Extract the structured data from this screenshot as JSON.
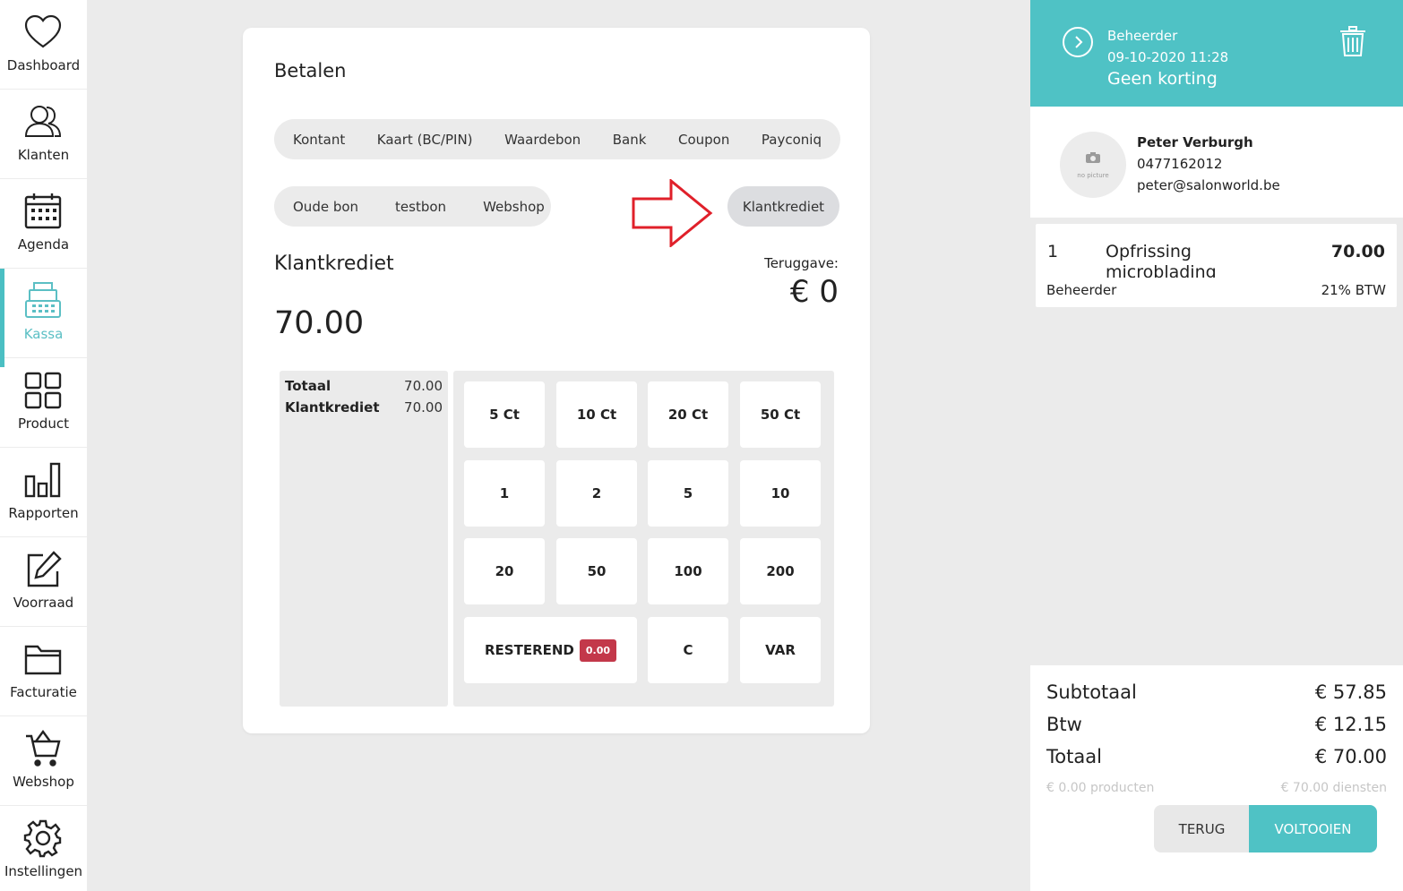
{
  "sidebar": {
    "items": [
      {
        "label": "Dashboard",
        "icon": "heart-icon"
      },
      {
        "label": "Klanten",
        "icon": "users-icon"
      },
      {
        "label": "Agenda",
        "icon": "calendar-icon"
      },
      {
        "label": "Kassa",
        "icon": "cash-register-icon",
        "active": true
      },
      {
        "label": "Product",
        "icon": "grid-icon"
      },
      {
        "label": "Rapporten",
        "icon": "bar-chart-icon"
      },
      {
        "label": "Voorraad",
        "icon": "edit-icon"
      },
      {
        "label": "Facturatie",
        "icon": "folder-icon"
      },
      {
        "label": "Webshop",
        "icon": "cart-icon"
      },
      {
        "label": "Instellingen",
        "icon": "gear-icon"
      }
    ]
  },
  "pay": {
    "title": "Betalen",
    "methods_row1": [
      "Kontant",
      "Kaart (BC/PIN)",
      "Waardebon",
      "Bank",
      "Coupon",
      "Payconiq"
    ],
    "methods_row2": [
      "Oude bon",
      "testbon",
      "Webshop"
    ],
    "selected_method": "Klantkrediet",
    "section_title": "Klantkrediet",
    "amount": "70.00",
    "return_label": "Teruggave:",
    "return_value": "€ 0"
  },
  "summary": {
    "rows": [
      {
        "label": "Totaal",
        "value": "70.00"
      },
      {
        "label": "Klantkrediet",
        "value": "70.00"
      }
    ]
  },
  "keypad": {
    "keys": [
      "5 Ct",
      "10 Ct",
      "20 Ct",
      "50 Ct",
      "1",
      "2",
      "5",
      "10",
      "20",
      "50",
      "100",
      "200"
    ],
    "remaining_label": "RESTEREND",
    "remaining_value": "0.00",
    "clear": "C",
    "var": "VAR"
  },
  "ticket": {
    "user": "Beheerder",
    "datetime": "09-10-2020 11:28",
    "discount": "Geen korting",
    "customer": {
      "photo_placeholder": "no picture",
      "name": "Peter Verburgh",
      "phone": "0477162012",
      "email": "peter@salonworld.be"
    },
    "items": [
      {
        "qty": "1",
        "name": "Opfrissing microblading",
        "price": "70.00",
        "staff": "Beheerder",
        "tax": "21% BTW"
      }
    ],
    "totals": {
      "subtotal_label": "Subtotaal",
      "subtotal": "€ 57.85",
      "tax_label": "Btw",
      "tax": "€ 12.15",
      "total_label": "Totaal",
      "total": "€ 70.00",
      "products": "€ 0.00 producten",
      "services": "€ 70.00 diensten"
    },
    "back_label": "TERUG",
    "done_label": "VOLTOOIEN"
  },
  "colors": {
    "accent": "#4fc2c5",
    "badge": "#c3384a",
    "arrow": "#e0202a"
  }
}
